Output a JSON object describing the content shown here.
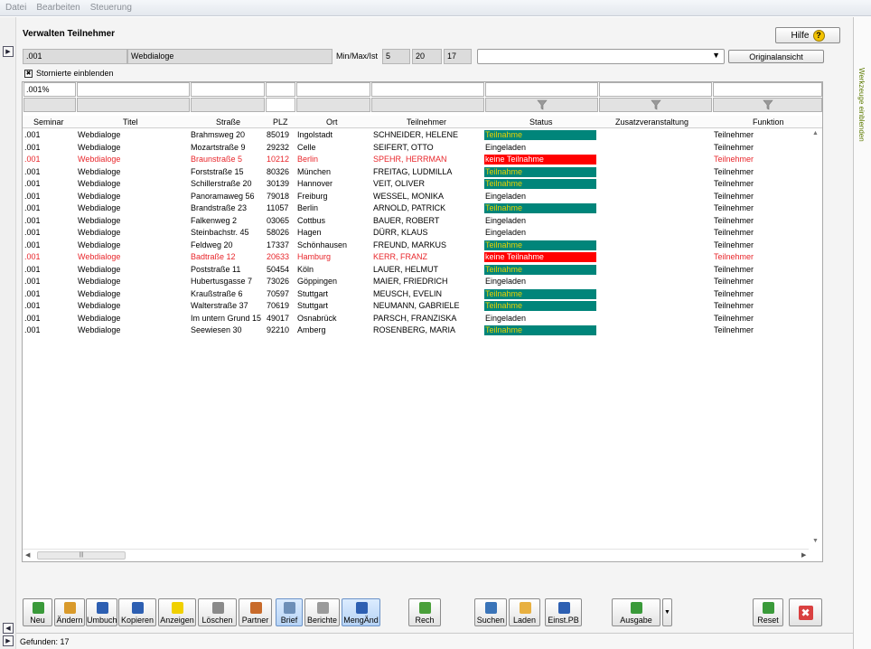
{
  "menu": [
    "Datei",
    "Bearbeiten",
    "Steuerung"
  ],
  "side_panel_label": "Werkzeuge einblenden",
  "page_title": "Verwalten Teilnehmer",
  "help_label": "Hilfe",
  "header": {
    "seminar_code": ".001",
    "seminar_title": "Webdialoge",
    "minmax_label": "Min/Max/Ist",
    "min": "5",
    "max": "20",
    "ist": "17",
    "view_select": "",
    "original_view_label": "Originalansicht"
  },
  "show_cancelled_label": "Stornierte einblenden",
  "filters": {
    "seminar": ".001%"
  },
  "columns": [
    "Seminar",
    "Titel",
    "Straße",
    "PLZ",
    "Ort",
    "Teilnehmer",
    "Status",
    "Zusatzveranstaltung",
    "Funktion"
  ],
  "rows": [
    {
      "seminar": ".001",
      "titel": "Webdialoge",
      "strasse": "Brahmsweg 20",
      "plz": "85019",
      "ort": "Ingolstadt",
      "teilnehmer": "SCHNEIDER, HELENE",
      "status": "Teilnahme",
      "zusatz": "",
      "funktion": "Teilnehmer"
    },
    {
      "seminar": ".001",
      "titel": "Webdialoge",
      "strasse": "Mozartstraße 9",
      "plz": "29232",
      "ort": "Celle",
      "teilnehmer": "SEIFERT, OTTO",
      "status": "Eingeladen",
      "zusatz": "",
      "funktion": "Teilnehmer"
    },
    {
      "seminar": ".001",
      "titel": "Webdialoge",
      "strasse": "Braunstraße 5",
      "plz": "10212",
      "ort": "Berlin",
      "teilnehmer": "SPEHR, HERRMAN",
      "status": "keine Teilnahme",
      "zusatz": "",
      "funktion": "Teilnehmer"
    },
    {
      "seminar": ".001",
      "titel": "Webdialoge",
      "strasse": "Forststraße 15",
      "plz": "80326",
      "ort": "München",
      "teilnehmer": "FREITAG, LUDMILLA",
      "status": "Teilnahme",
      "zusatz": "",
      "funktion": "Teilnehmer"
    },
    {
      "seminar": ".001",
      "titel": "Webdialoge",
      "strasse": "Schillerstraße 20",
      "plz": "30139",
      "ort": "Hannover",
      "teilnehmer": "VEIT, OLIVER",
      "status": "Teilnahme",
      "zusatz": "",
      "funktion": "Teilnehmer"
    },
    {
      "seminar": ".001",
      "titel": "Webdialoge",
      "strasse": "Panoramaweg 56",
      "plz": "79018",
      "ort": "Freiburg",
      "teilnehmer": "WESSEL, MONIKA",
      "status": "Eingeladen",
      "zusatz": "",
      "funktion": "Teilnehmer"
    },
    {
      "seminar": ".001",
      "titel": "Webdialoge",
      "strasse": "Brandstraße 23",
      "plz": "11057",
      "ort": "Berlin",
      "teilnehmer": "ARNOLD, PATRICK",
      "status": "Teilnahme",
      "zusatz": "",
      "funktion": "Teilnehmer"
    },
    {
      "seminar": ".001",
      "titel": "Webdialoge",
      "strasse": "Falkenweg 2",
      "plz": "03065",
      "ort": "Cottbus",
      "teilnehmer": "BAUER, ROBERT",
      "status": "Eingeladen",
      "zusatz": "",
      "funktion": "Teilnehmer"
    },
    {
      "seminar": ".001",
      "titel": "Webdialoge",
      "strasse": "Steinbachstr. 45",
      "plz": "58026",
      "ort": "Hagen",
      "teilnehmer": "DÜRR, KLAUS",
      "status": "Eingeladen",
      "zusatz": "",
      "funktion": "Teilnehmer"
    },
    {
      "seminar": ".001",
      "titel": "Webdialoge",
      "strasse": "Feldweg 20",
      "plz": "17337",
      "ort": "Schönhausen",
      "teilnehmer": "FREUND, MARKUS",
      "status": "Teilnahme",
      "zusatz": "",
      "funktion": "Teilnehmer"
    },
    {
      "seminar": ".001",
      "titel": "Webdialoge",
      "strasse": "Badtraße 12",
      "plz": "20633",
      "ort": "Hamburg",
      "teilnehmer": "KERR, FRANZ",
      "status": "keine Teilnahme",
      "zusatz": "",
      "funktion": "Teilnehmer"
    },
    {
      "seminar": ".001",
      "titel": "Webdialoge",
      "strasse": "Poststraße 11",
      "plz": "50454",
      "ort": "Köln",
      "teilnehmer": "LAUER, HELMUT",
      "status": "Teilnahme",
      "zusatz": "",
      "funktion": "Teilnehmer"
    },
    {
      "seminar": ".001",
      "titel": "Webdialoge",
      "strasse": "Hubertusgasse 7",
      "plz": "73026",
      "ort": "Göppingen",
      "teilnehmer": "MAIER, FRIEDRICH",
      "status": "Eingeladen",
      "zusatz": "",
      "funktion": "Teilnehmer"
    },
    {
      "seminar": ".001",
      "titel": "Webdialoge",
      "strasse": "Kraußstraße 6",
      "plz": "70597",
      "ort": "Stuttgart",
      "teilnehmer": "MEUSCH, EVELIN",
      "status": "Teilnahme",
      "zusatz": "",
      "funktion": "Teilnehmer"
    },
    {
      "seminar": ".001",
      "titel": "Webdialoge",
      "strasse": "Walterstraße 37",
      "plz": "70619",
      "ort": "Stuttgart",
      "teilnehmer": "NEUMANN, GABRIELE",
      "status": "Teilnahme",
      "zusatz": "",
      "funktion": "Teilnehmer"
    },
    {
      "seminar": ".001",
      "titel": "Webdialoge",
      "strasse": "Im untern Grund 15",
      "plz": "49017",
      "ort": "Osnabrück",
      "teilnehmer": "PARSCH, FRANZISKA",
      "status": "Eingeladen",
      "zusatz": "",
      "funktion": "Teilnehmer"
    },
    {
      "seminar": ".001",
      "titel": "Webdialoge",
      "strasse": "Seewiesen 30",
      "plz": "92210",
      "ort": "Amberg",
      "teilnehmer": "ROSENBERG, MARIA",
      "status": "Teilnahme",
      "zusatz": "",
      "funktion": "Teilnehmer"
    }
  ],
  "status_colors": {
    "Teilnahme": {
      "bg": "#00857a",
      "fg": "#e8d100"
    },
    "keine Teilnahme": {
      "bg": "#ff0000",
      "fg": "#ffffff"
    },
    "Eingeladen": {
      "bg": "transparent",
      "fg": "#000000"
    }
  },
  "toolbar": [
    {
      "name": "neu",
      "label": "Neu",
      "icon": "plus-icon",
      "color": "#3a9a3a"
    },
    {
      "name": "aendern",
      "label": "Ändern",
      "icon": "pencil-icon",
      "color": "#d99a2b"
    },
    {
      "name": "umbuch",
      "label": "Umbuch",
      "icon": "transfer-icon",
      "color": "#2d5fb2"
    },
    {
      "name": "kopieren",
      "label": "Kopieren",
      "icon": "copy-icon",
      "color": "#2d5fb2"
    },
    {
      "name": "anzeigen",
      "label": "Anzeigen",
      "icon": "bulb-icon",
      "color": "#f0d000"
    },
    {
      "name": "loeschen",
      "label": "Löschen",
      "icon": "trash-icon",
      "color": "#8a8a8a"
    },
    {
      "name": "partner",
      "label": "Partner",
      "icon": "person-icon",
      "color": "#c86a2a"
    },
    {
      "name": "brief",
      "label": "Brief",
      "icon": "letter-icon",
      "color": "#6d8fb8"
    },
    {
      "name": "berichte",
      "label": "Berichte",
      "icon": "report-icon",
      "color": "#9a9a9a"
    },
    {
      "name": "mengaend",
      "label": "MengÄnd",
      "icon": "list-edit-icon",
      "color": "#2d5fb2"
    },
    {
      "name": "rech",
      "label": "Rech",
      "icon": "invoice-icon",
      "color": "#4aa03a"
    },
    {
      "name": "suchen",
      "label": "Suchen",
      "icon": "magnifier-icon",
      "color": "#3a74b8"
    },
    {
      "name": "laden",
      "label": "Laden",
      "icon": "folder-icon",
      "color": "#e8b040"
    },
    {
      "name": "einst-pb",
      "label": "Einst.PB",
      "icon": "settings-icon",
      "color": "#2d5fb2"
    },
    {
      "name": "ausgabe",
      "label": "Ausgabe",
      "icon": "export-icon",
      "color": "#3a9a3a"
    },
    {
      "name": "reset",
      "label": "Reset",
      "icon": "refresh-icon",
      "color": "#3a9a3a"
    },
    {
      "name": "close",
      "label": "",
      "icon": "close-icon",
      "color": "#d94040"
    }
  ],
  "status_bar": "Gefunden: 17"
}
